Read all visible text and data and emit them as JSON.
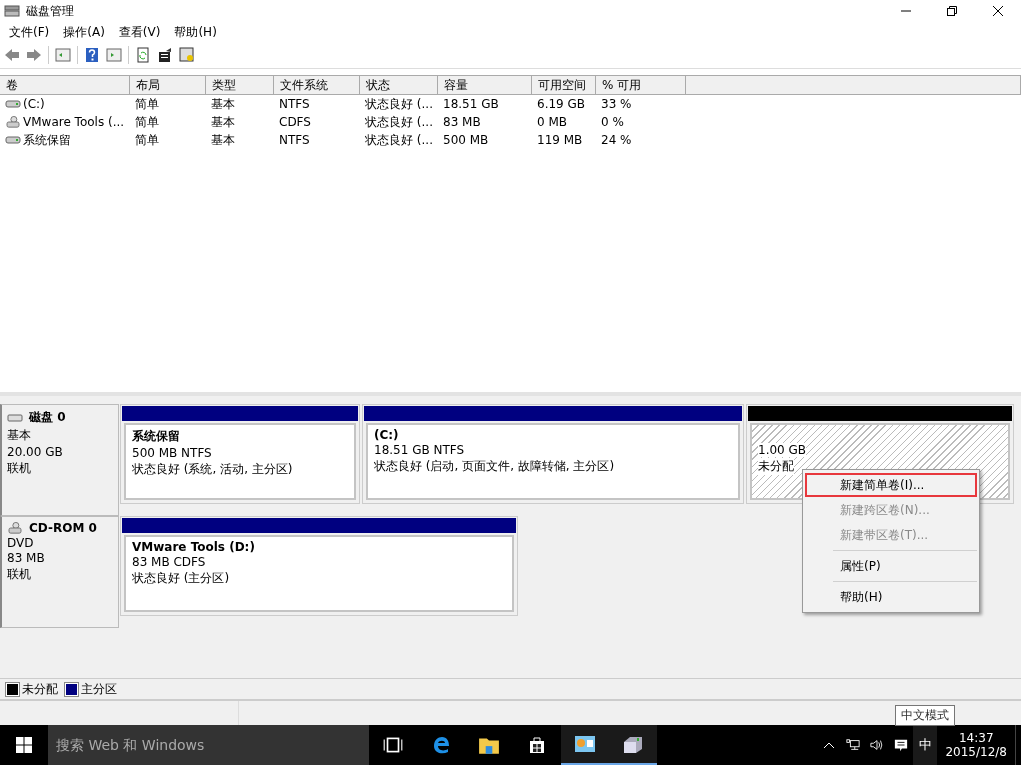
{
  "window": {
    "title": "磁盘管理"
  },
  "menu": [
    "文件(F)",
    "操作(A)",
    "查看(V)",
    "帮助(H)"
  ],
  "table": {
    "columns": [
      "卷",
      "布局",
      "类型",
      "文件系统",
      "状态",
      "容量",
      "可用空间",
      "% 可用"
    ],
    "rows": [
      {
        "kind": "hdd",
        "cells": [
          " (C:)",
          "简单",
          "基本",
          "NTFS",
          "状态良好 (...",
          "18.51 GB",
          "6.19 GB",
          "33 %"
        ]
      },
      {
        "kind": "cd",
        "cells": [
          "VMware Tools (...",
          "简单",
          "基本",
          "CDFS",
          "状态良好 (...",
          "83 MB",
          "0 MB",
          "0 %"
        ]
      },
      {
        "kind": "hdd",
        "cells": [
          "系统保留",
          "简单",
          "基本",
          "NTFS",
          "状态良好 (...",
          "500 MB",
          "119 MB",
          "24 %"
        ]
      }
    ]
  },
  "disks": [
    {
      "kind": "hdd",
      "name": "磁盘 0",
      "type": "基本",
      "size": "20.00 GB",
      "status": "联机",
      "partitions": [
        {
          "kind": "primary",
          "color": "#000080",
          "title": "系统保留",
          "size": "500 MB NTFS",
          "status": "状态良好 (系统, 活动, 主分区)"
        },
        {
          "kind": "primary",
          "color": "#000080",
          "title": " (C:)",
          "size": "18.51 GB NTFS",
          "status": "状态良好 (启动, 页面文件, 故障转储, 主分区)"
        },
        {
          "kind": "unallocated",
          "color": "#000000",
          "size": "1.00 GB",
          "status": "未分配"
        }
      ]
    },
    {
      "kind": "cd",
      "name": "CD-ROM 0",
      "type": "DVD",
      "size": "83 MB",
      "status": "联机",
      "partitions": [
        {
          "kind": "primary",
          "color": "#000080",
          "title": "VMware Tools  (D:)",
          "size": "83 MB CDFS",
          "status": "状态良好 (主分区)"
        }
      ]
    }
  ],
  "context_menu": [
    {
      "kind": "item",
      "label": "新建简单卷(I)...",
      "disabled": false,
      "selected": true
    },
    {
      "kind": "item",
      "label": "新建跨区卷(N)...",
      "disabled": true,
      "selected": false
    },
    {
      "kind": "item",
      "label": "新建带区卷(T)...",
      "disabled": true,
      "selected": false
    },
    {
      "kind": "separator"
    },
    {
      "kind": "item",
      "label": "属性(P)",
      "disabled": false,
      "selected": false
    },
    {
      "kind": "separator"
    },
    {
      "kind": "item",
      "label": "帮助(H)",
      "disabled": false,
      "selected": false
    }
  ],
  "legend": [
    {
      "color": "#000000",
      "label": "未分配"
    },
    {
      "color": "#000080",
      "label": "主分区"
    }
  ],
  "tooltip": "中文模式",
  "taskbar": {
    "search": {
      "placeholder": "搜索 Web 和 Windows"
    },
    "apps": [
      {
        "kind": "taskview",
        "active": false
      },
      {
        "kind": "edge",
        "active": false
      },
      {
        "kind": "explorer",
        "active": false
      },
      {
        "kind": "store",
        "active": false
      },
      {
        "kind": "control",
        "active": true
      },
      {
        "kind": "diskmgmt",
        "active": true
      }
    ],
    "ime": "中",
    "time": "14:37",
    "date": "2015/12/8"
  }
}
